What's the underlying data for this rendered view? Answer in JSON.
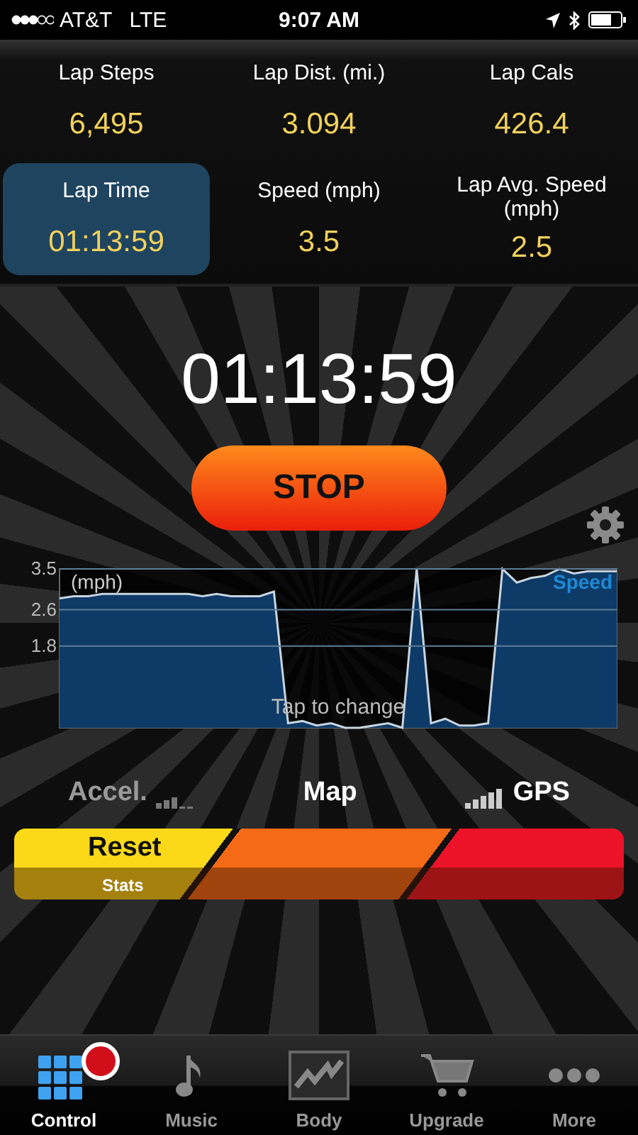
{
  "status_bar": {
    "carrier": "AT&T",
    "network": "LTE",
    "time": "9:07 AM"
  },
  "stats": [
    {
      "label": "Lap Steps",
      "value": "6,495",
      "selected": false
    },
    {
      "label": "Lap Dist. (mi.)",
      "value": "3.094",
      "selected": false
    },
    {
      "label": "Lap Cals",
      "value": "426.4",
      "selected": false
    },
    {
      "label": "Lap Time",
      "value": "01:13:59",
      "selected": true
    },
    {
      "label": "Speed (mph)",
      "value": "3.5",
      "selected": false
    },
    {
      "label": "Lap Avg. Speed (mph)",
      "value": "2.5",
      "selected": false
    }
  ],
  "timer": "01:13:59",
  "stop_button": "STOP",
  "speed_chart": {
    "unit_label": "(mph)",
    "hint": "Tap to change",
    "chart_data": {
      "type": "area",
      "ylim": [
        0,
        3.5
      ],
      "yticks": [
        1.8,
        2.6,
        3.5
      ],
      "series": [
        {
          "name": "Speed",
          "color": "#0d3a66",
          "values": [
            2.85,
            2.9,
            2.9,
            2.95,
            2.95,
            2.95,
            2.95,
            2.95,
            2.95,
            2.95,
            2.9,
            2.95,
            2.9,
            2.9,
            2.9,
            3.0,
            0.1,
            0.15,
            0.05,
            0.1,
            0.0,
            0.0,
            0.05,
            0.1,
            0.0,
            3.5,
            0.1,
            0.2,
            0.05,
            0.05,
            0.1,
            3.5,
            3.2,
            3.3,
            3.35,
            3.5,
            3.4,
            3.45,
            3.45,
            3.45
          ]
        }
      ]
    }
  },
  "sensors": [
    {
      "kind": "accel",
      "label": "Accel.",
      "enabled": false
    },
    {
      "kind": "map",
      "label": "Map",
      "enabled": true
    },
    {
      "kind": "gps",
      "label": "GPS",
      "enabled": true
    }
  ],
  "slider": {
    "title": "Reset",
    "subtitle": "Stats"
  },
  "tabs": [
    {
      "label": "Control",
      "selected": true,
      "recording": true
    },
    {
      "label": "Music",
      "selected": false,
      "recording": false
    },
    {
      "label": "Body",
      "selected": false,
      "recording": false
    },
    {
      "label": "Upgrade",
      "selected": false,
      "recording": false
    },
    {
      "label": "More",
      "selected": false,
      "recording": false
    }
  ]
}
